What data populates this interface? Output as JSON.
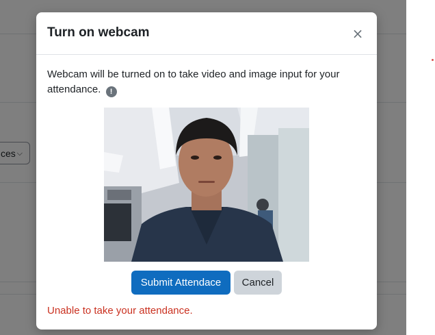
{
  "background": {
    "select_partial_label": "ces",
    "accent_red": "#d9534f"
  },
  "modal": {
    "title": "Turn on webcam",
    "close_glyph": "×",
    "message": "Webcam will be turned on to take video and image input for your attendance.",
    "info_glyph": "!",
    "webcam_feed": "webcam-video-preview",
    "submit_label": "Submit Attendace",
    "cancel_label": "Cancel",
    "error_message": "Unable to take your attendance."
  },
  "colors": {
    "primary": "#0f6cbf",
    "secondary": "#ced4da",
    "danger": "#ca3120",
    "text": "#1d2125"
  }
}
